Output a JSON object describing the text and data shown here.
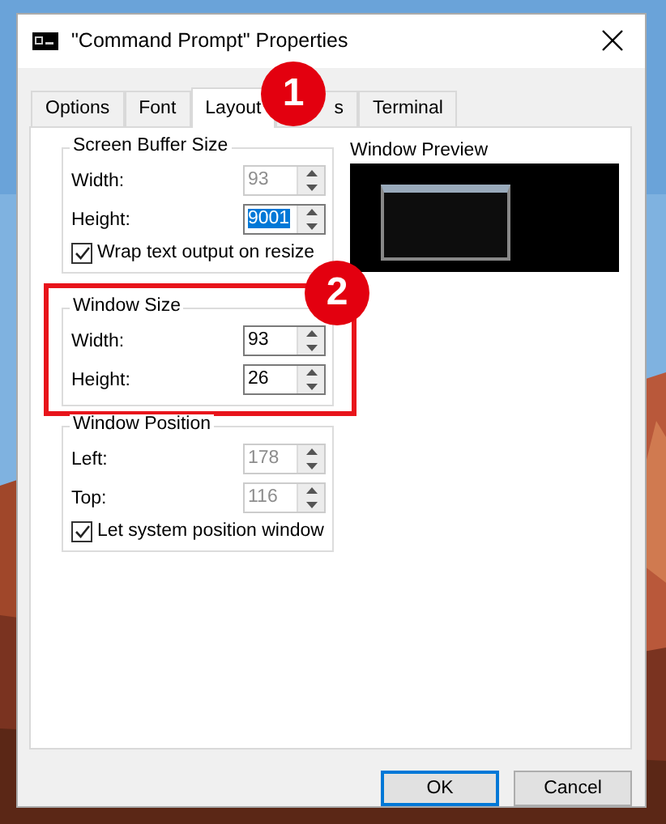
{
  "window": {
    "title": "\"Command Prompt\" Properties"
  },
  "tabs": [
    {
      "label": "Options",
      "selected": false
    },
    {
      "label": "Font",
      "selected": false
    },
    {
      "label": "Layout",
      "selected": true
    },
    {
      "label": "s",
      "selected": false
    },
    {
      "label": "Terminal",
      "selected": false
    }
  ],
  "groups": [
    {
      "title": "Screen Buffer Size",
      "highlighted": false,
      "fields": [
        {
          "label": "Width:",
          "value": "93",
          "disabled": true,
          "selected": false
        },
        {
          "label": "Height:",
          "value": "9001",
          "disabled": false,
          "selected": true
        }
      ],
      "checkbox": {
        "label": "Wrap text output on resize",
        "checked": true
      }
    },
    {
      "title": "Window Size",
      "highlighted": true,
      "fields": [
        {
          "label": "Width:",
          "value": "93",
          "disabled": false,
          "selected": false
        },
        {
          "label": "Height:",
          "value": "26",
          "disabled": false,
          "selected": false
        }
      ]
    },
    {
      "title": "Window Position",
      "highlighted": false,
      "fields": [
        {
          "label": "Left:",
          "value": "178",
          "disabled": true,
          "selected": false
        },
        {
          "label": "Top:",
          "value": "116",
          "disabled": true,
          "selected": false
        }
      ],
      "checkbox": {
        "label": "Let system position window",
        "checked": true
      }
    }
  ],
  "preview": {
    "title": "Window Preview"
  },
  "callouts": [
    {
      "number": "1"
    },
    {
      "number": "2"
    }
  ],
  "buttons": [
    {
      "label": "OK",
      "default": true
    },
    {
      "label": "Cancel",
      "default": false
    }
  ]
}
